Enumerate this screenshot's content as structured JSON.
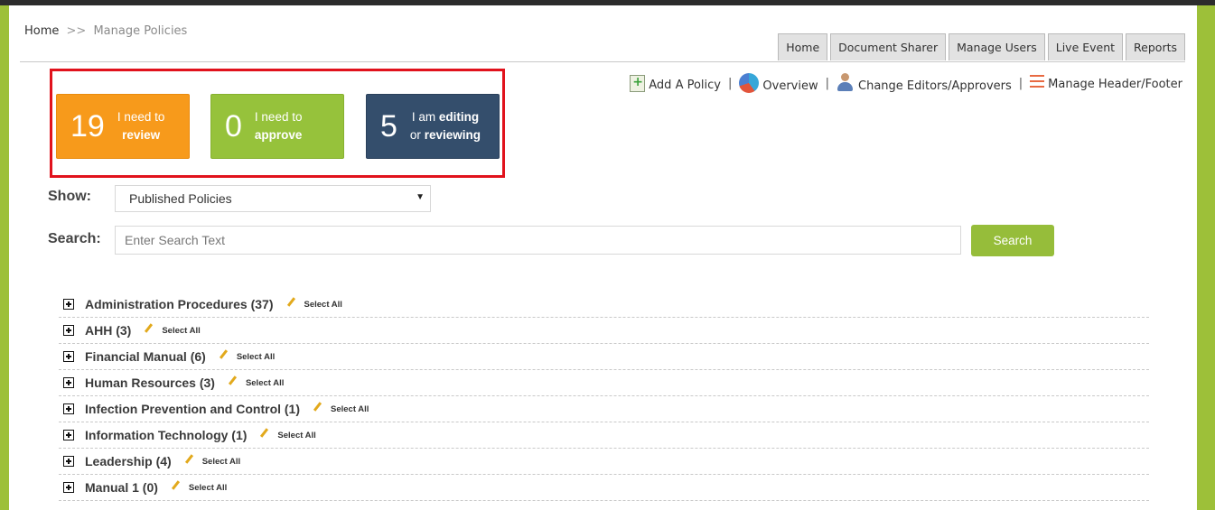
{
  "breadcrumb": {
    "home": "Home",
    "separator": ">>",
    "current": "Manage Policies"
  },
  "nav_tabs": [
    "Home",
    "Document Sharer",
    "Manage Users",
    "Live Event",
    "Reports"
  ],
  "toolbar": {
    "add_policy": "Add A Policy",
    "overview": "Overview",
    "change_editors": "Change Editors/Approvers",
    "manage_header_footer": "Manage Header/Footer",
    "separator": "|"
  },
  "tiles": {
    "review": {
      "count": "19",
      "line1": "I need to",
      "line2": "review",
      "color": "#f79a1b"
    },
    "approve": {
      "count": "0",
      "line1": "I need to",
      "line2": "approve",
      "color": "#96c23b"
    },
    "editing": {
      "count": "5",
      "line1_pre": "I am ",
      "line1_bold": "editing",
      "line2_pre": "or ",
      "line2_bold": "reviewing",
      "color": "#344e6c"
    }
  },
  "filter": {
    "show_label": "Show:",
    "selected": "Published Policies",
    "arrow": "▼"
  },
  "search": {
    "label": "Search:",
    "placeholder": "Enter Search Text",
    "button": "Search"
  },
  "categories": [
    {
      "name": "Administration Procedures (37)",
      "action": "Select All"
    },
    {
      "name": "AHH (3)",
      "action": "Select All"
    },
    {
      "name": "Financial Manual (6)",
      "action": "Select All"
    },
    {
      "name": "Human Resources (3)",
      "action": "Select All"
    },
    {
      "name": "Infection Prevention and Control (1)",
      "action": "Select All"
    },
    {
      "name": "Information Technology (1)",
      "action": "Select All"
    },
    {
      "name": "Leadership (4)",
      "action": "Select All"
    },
    {
      "name": "Manual 1 (0)",
      "action": "Select All"
    }
  ],
  "colors": {
    "accent_green": "#96bd3a",
    "highlight_red": "#e1121c",
    "frame_green": "#9dc039"
  }
}
